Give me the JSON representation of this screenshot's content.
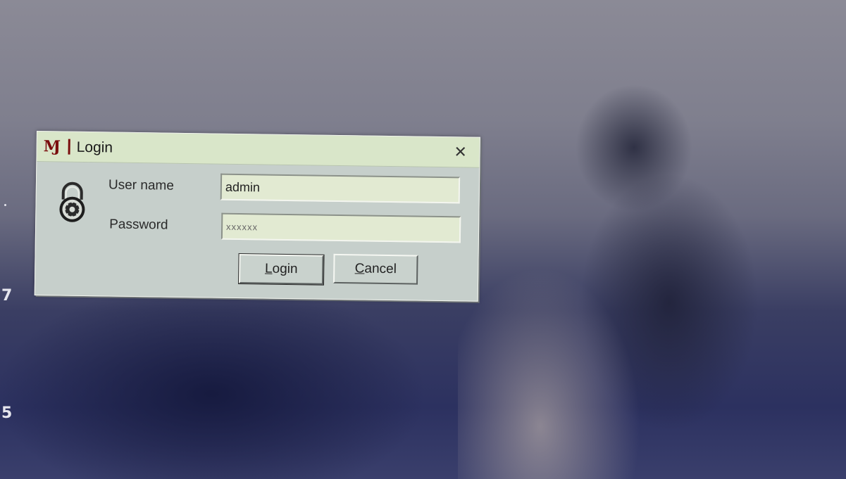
{
  "dialog": {
    "title": "Login",
    "app_icon_glyph": "Ɱ",
    "icons": {
      "app": "app-logo-icon",
      "close": "close-icon",
      "lock": "padlock-icon"
    },
    "username_label": "User name",
    "username_value": "admin",
    "password_label": "Password",
    "password_value": "xxxxxx",
    "login_button": {
      "mnemonic": "L",
      "rest": "ogin"
    },
    "cancel_button": {
      "mnemonic": "C",
      "rest": "ancel"
    }
  },
  "background": {
    "edge_digits": [
      "7",
      "5"
    ]
  },
  "colors": {
    "titlebar": "#d9e6c9",
    "dialog_body": "#c6cfcb",
    "field_bg": "#e2ead2",
    "app_icon": "#7a0d0d"
  }
}
